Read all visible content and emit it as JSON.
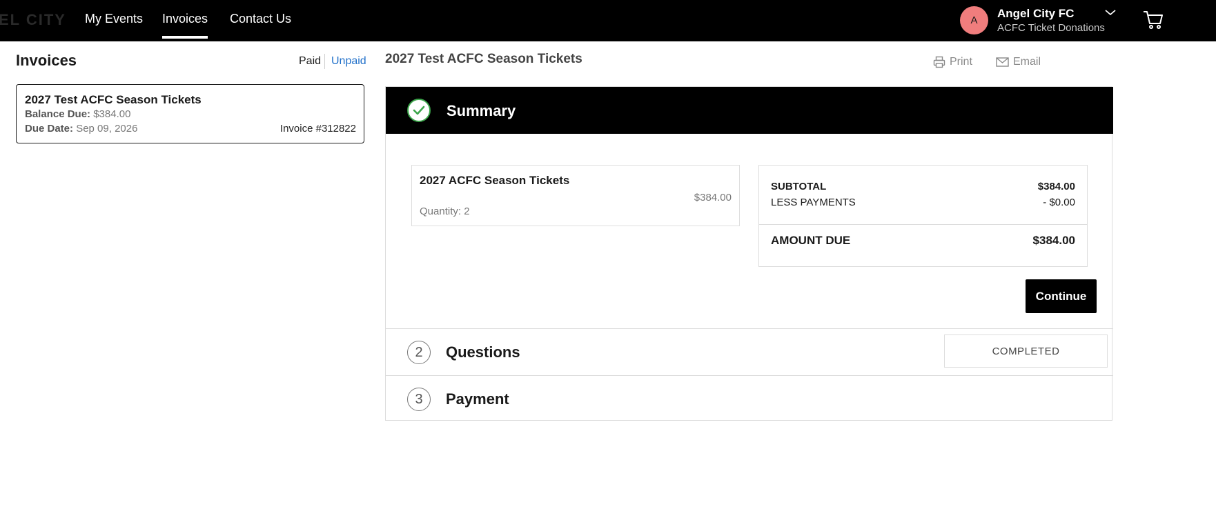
{
  "header": {
    "logo_text": "EL CITY",
    "nav": [
      {
        "label": "My Events"
      },
      {
        "label": "Invoices"
      },
      {
        "label": "Contact Us"
      }
    ],
    "active_nav": "Invoices",
    "account": {
      "avatar_initial": "A",
      "name": "Angel City FC",
      "subtitle": "ACFC Ticket Donations"
    },
    "icons": [
      "chevron-down-icon",
      "cart-icon"
    ]
  },
  "sidebar": {
    "title": "Invoices",
    "filters": {
      "paid": "Paid",
      "unpaid": "Unpaid",
      "active": "Unpaid"
    },
    "invoices": [
      {
        "title": "2027 Test ACFC Season Tickets",
        "balance_label": "Balance Due:",
        "balance_value": "$384.00",
        "due_label": "Due Date:",
        "due_value": "Sep 09, 2026",
        "invoice_number": "Invoice #312822"
      }
    ]
  },
  "main": {
    "title": "2027 Test ACFC Season Tickets",
    "actions": {
      "print": "Print",
      "email": "Email"
    },
    "summary": {
      "label": "Summary",
      "item": {
        "name": "2027 ACFC Season Tickets",
        "price": "$384.00",
        "quantity": "Quantity: 2"
      },
      "totals": {
        "subtotal_label": "SUBTOTAL",
        "subtotal_value": "$384.00",
        "less_payments_label": "LESS PAYMENTS",
        "less_payments_value": "- $0.00",
        "amount_due_label": "AMOUNT DUE",
        "amount_due_value": "$384.00"
      },
      "continue_label": "Continue"
    },
    "steps": [
      {
        "number": "2",
        "label": "Questions",
        "status": "COMPLETED"
      },
      {
        "number": "3",
        "label": "Payment"
      }
    ]
  },
  "colors": {
    "topbar": "#000000",
    "accent_link": "#1f6fc9",
    "check_green": "#3ca64b",
    "avatar": "#f07d7d"
  }
}
